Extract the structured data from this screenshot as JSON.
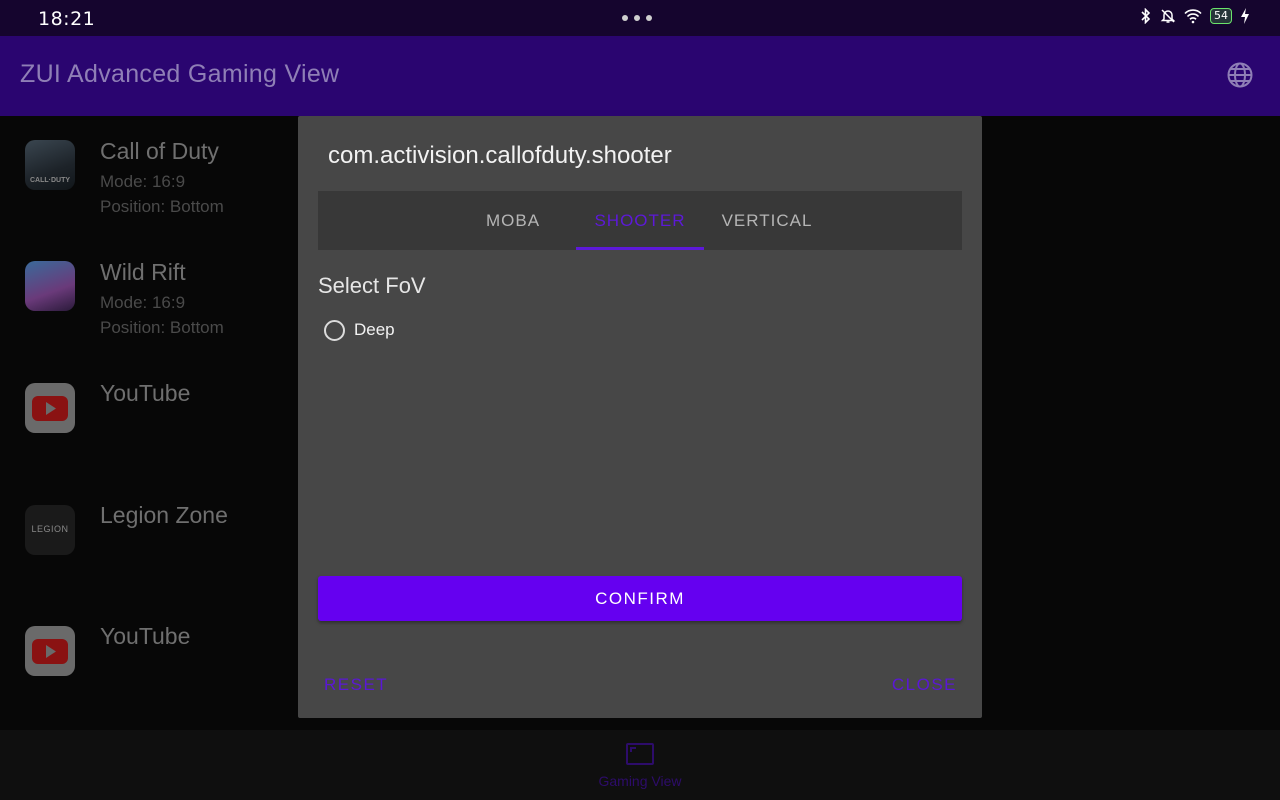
{
  "status_bar": {
    "time": "18:21",
    "battery": "54"
  },
  "app_bar": {
    "title": "ZUI Advanced Gaming View"
  },
  "apps": [
    {
      "name": "Call of Duty",
      "mode": "Mode: 16:9",
      "position": "Position: Bottom",
      "icon_text": "CALL·DUTY"
    },
    {
      "name": "Wild Rift",
      "mode": "Mode: 16:9",
      "position": "Position: Bottom",
      "icon_text": ""
    },
    {
      "name": "YouTube",
      "mode": "",
      "position": "",
      "icon_text": ""
    },
    {
      "name": "Legion Zone",
      "mode": "",
      "position": "",
      "icon_text": "LEGION"
    },
    {
      "name": "YouTube",
      "mode": "",
      "position": "",
      "icon_text": ""
    }
  ],
  "dialog": {
    "package": "com.activision.callofduty.shooter",
    "tabs": [
      {
        "label": "MOBA",
        "active": false
      },
      {
        "label": "SHOOTER",
        "active": true
      },
      {
        "label": "VERTICAL",
        "active": false
      }
    ],
    "section_title": "Select FoV",
    "options": [
      {
        "label": "Deep",
        "selected": false
      }
    ],
    "confirm_label": "CONFIRM",
    "reset_label": "RESET",
    "close_label": "CLOSE"
  },
  "bottom_nav": {
    "label": "Gaming View"
  },
  "colors": {
    "accent": "#6500f0",
    "app_bar": "#2a0570",
    "dialog_bg": "#474747"
  }
}
